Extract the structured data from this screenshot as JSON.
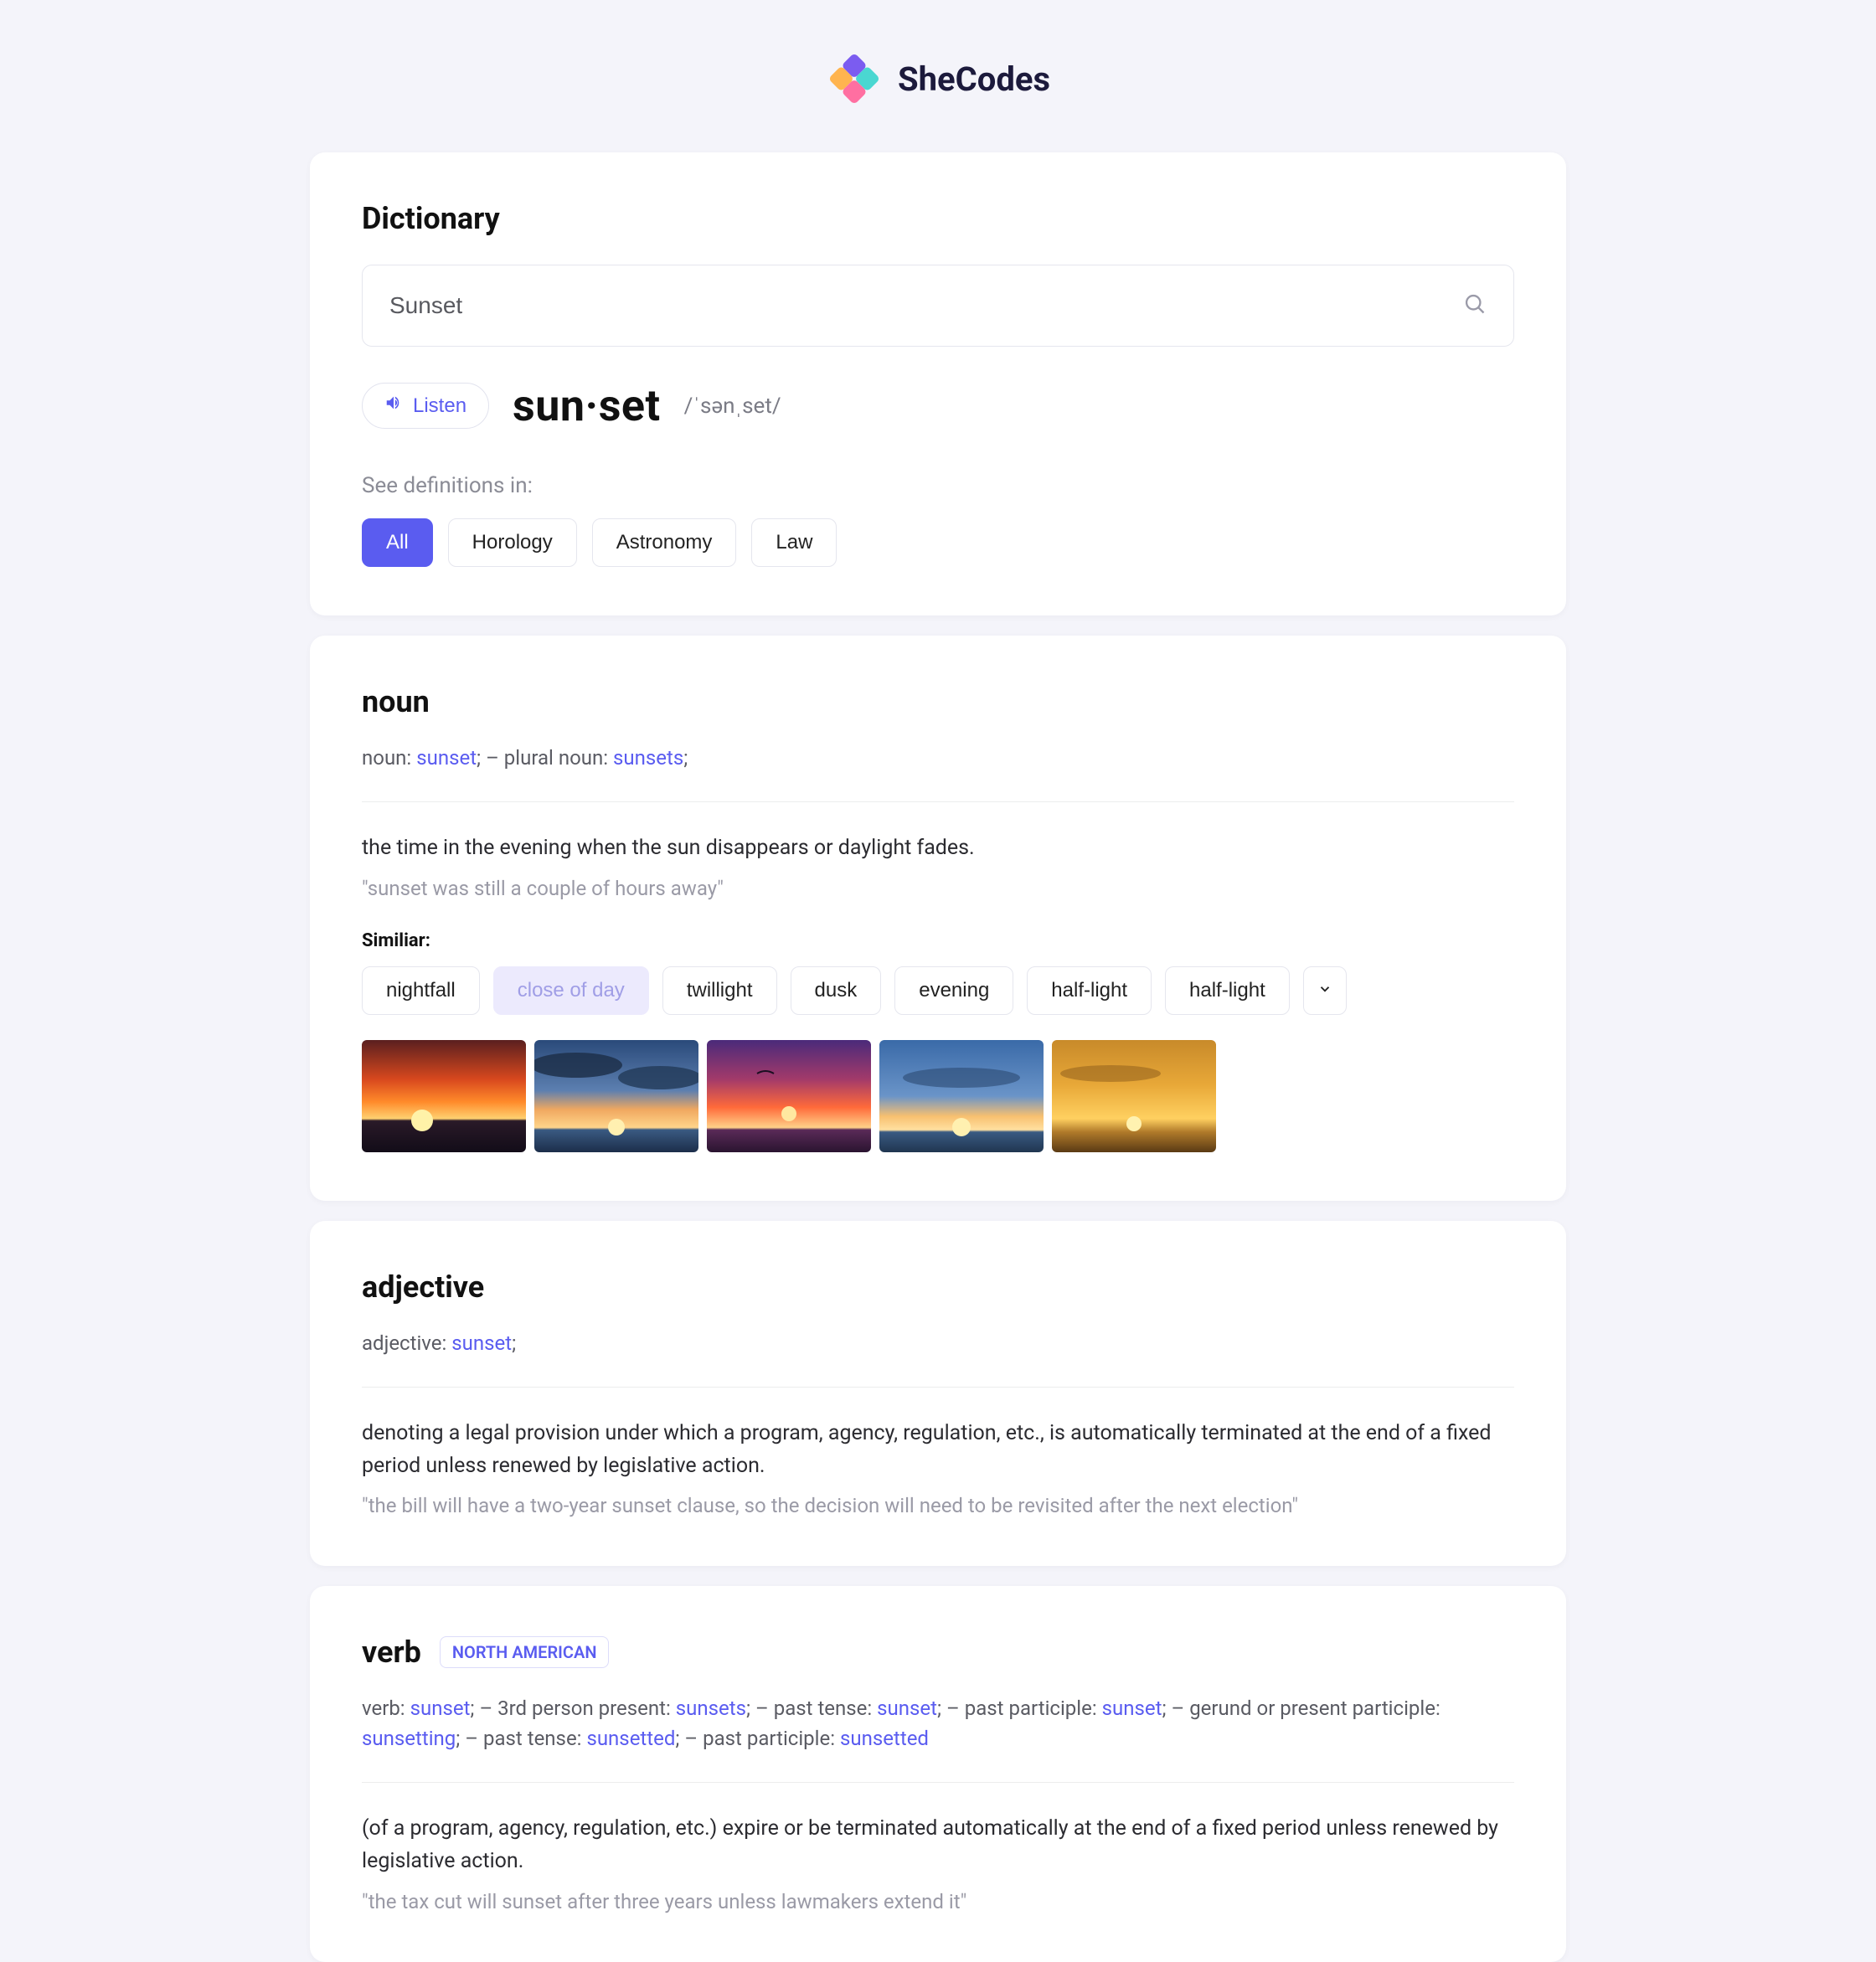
{
  "logo": {
    "text": "SheCodes"
  },
  "page": {
    "title": "Dictionary"
  },
  "search": {
    "value": "Sunset"
  },
  "listen_label": "Listen",
  "headword": "sun·set",
  "phonetic": "/ˈsənˌset/",
  "see_definitions_label": "See definitions in:",
  "filters": [
    {
      "label": "All",
      "active": true
    },
    {
      "label": "Horology",
      "active": false
    },
    {
      "label": "Astronomy",
      "active": false
    },
    {
      "label": "Law",
      "active": false
    }
  ],
  "sections": {
    "noun": {
      "title": "noun",
      "forms": [
        {
          "prefix": "noun: ",
          "word": "sunset",
          "suffix": ";"
        },
        {
          "sep": "  –  "
        },
        {
          "prefix": "plural noun: ",
          "word": "sunsets",
          "suffix": ";"
        }
      ],
      "definition": "the time in the evening when the sun disappears or daylight fades.",
      "example": "\"sunset was still a couple of hours away\"",
      "similar_label": "Similiar:",
      "similar": [
        {
          "label": "nightfall"
        },
        {
          "label": "close of day",
          "muted": true
        },
        {
          "label": "twillight"
        },
        {
          "label": "dusk"
        },
        {
          "label": "evening"
        },
        {
          "label": "half-light"
        },
        {
          "label": "half-light"
        }
      ]
    },
    "adjective": {
      "title": "adjective",
      "forms": [
        {
          "prefix": "adjective: ",
          "word": "sunset",
          "suffix": ";"
        }
      ],
      "definition": "denoting a legal provision under which a program, agency, regulation, etc., is automatically terminated at the end of a fixed period unless renewed by legislative action.",
      "example": "\"the bill will have a two-year sunset clause, so the decision will need to be revisited after the next election\""
    },
    "verb": {
      "title": "verb",
      "badge": "NORTH AMERICAN",
      "forms": [
        {
          "prefix": "verb: ",
          "word": "sunset",
          "suffix": ";"
        },
        {
          "sep": "  –  "
        },
        {
          "prefix": "3rd person present: ",
          "word": "sunsets",
          "suffix": ";"
        },
        {
          "sep": "  –  "
        },
        {
          "prefix": "past tense: ",
          "word": "sunset",
          "suffix": ";"
        },
        {
          "sep": "  –  "
        },
        {
          "prefix": "past participle: ",
          "word": "sunset",
          "suffix": ";"
        },
        {
          "sep": "  –  "
        },
        {
          "prefix": "gerund or present participle: ",
          "word": "sunsetting",
          "suffix": ";"
        },
        {
          "sep": "  –  "
        },
        {
          "prefix": "past tense: ",
          "word": "sunsetted",
          "suffix": ";"
        },
        {
          "sep": "  –  "
        },
        {
          "prefix": "past participle: ",
          "word": "sunsetted",
          "suffix": ""
        }
      ],
      "definition": "(of a program, agency, regulation, etc.) expire or be terminated automatically at the end of a fixed period unless renewed by legislative action.",
      "example": "\"the tax cut will sunset after three years unless lawmakers extend it\""
    }
  }
}
